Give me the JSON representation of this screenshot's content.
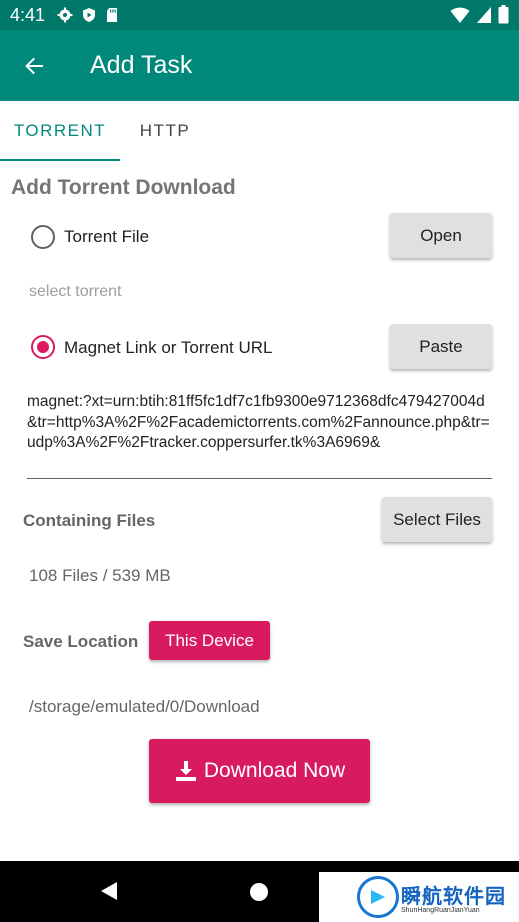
{
  "status_bar": {
    "time": "4:41"
  },
  "app_bar": {
    "title": "Add Task"
  },
  "tabs": [
    {
      "label": "TORRENT"
    },
    {
      "label": "HTTP"
    }
  ],
  "form": {
    "section_title": "Add Torrent Download",
    "torrent_file_label": "Torrent File",
    "open_button": "Open",
    "select_torrent_hint": "select torrent",
    "magnet_label": "Magnet Link or Torrent URL",
    "paste_button": "Paste",
    "url_value": "magnet:?xt=urn:btih:81ff5fc1df7c1fb9300e9712368dfc479427004d&tr=http%3A%2F%2Facademictorrents.com%2Fannounce.php&tr=udp%3A%2F%2Ftracker.coppersurfer.tk%3A6969&",
    "containing_files_label": "Containing Files",
    "select_files_button": "Select Files",
    "files_info": "108 Files / 539 MB",
    "save_location_label": "Save Location",
    "this_device_button": "This Device",
    "path": "/storage/emulated/0/Download",
    "download_button": "Download Now"
  },
  "watermark": {
    "main": "瞬航软件园",
    "sub": "ShunHangRuanJianYuan"
  },
  "colors": {
    "primary": "#00897b",
    "primary_dark": "#00796b",
    "accent": "#d81b60"
  }
}
